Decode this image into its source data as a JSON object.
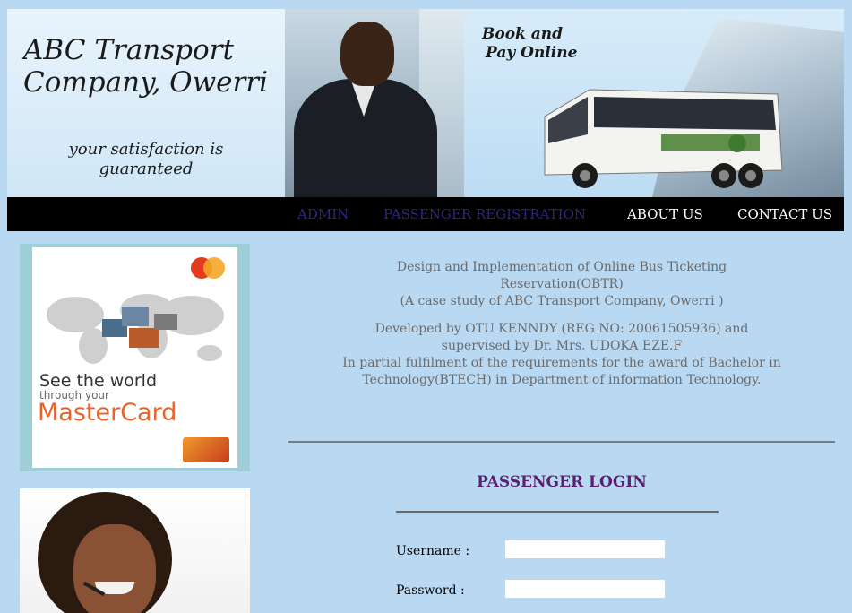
{
  "header": {
    "brand_title": "ABC Transport Company, Owerri",
    "tagline": "your satisfaction is guaranteed",
    "promo_line1": "Book and",
    "promo_line2": "Pay Online"
  },
  "nav": {
    "items": [
      {
        "label": "ADMIN",
        "color": "#3a1f8a"
      },
      {
        "label": "PASSENGER REGISTRATION",
        "color": "#3a1f8a"
      },
      {
        "label": "ABOUT US",
        "color": "#ffffff"
      },
      {
        "label": "CONTACT US",
        "color": "#ffffff"
      }
    ]
  },
  "sidebar": {
    "mastercard_ad": {
      "line1": "See the world",
      "line2": "through your",
      "brand": "MasterCard",
      "brand_color": "#e8632a"
    }
  },
  "main": {
    "project_title_line1": "Design and Implementation of Online Bus Ticketing",
    "project_title_line2": "Reservation(OBTR)",
    "case_study": "(A case study of ABC Transport Company, Owerri )",
    "developer_line1": "Developed by OTU KENNDY (REG NO: 20061505936) and",
    "developer_line2": "supervised by Dr. Mrs. UDOKA EZE.F",
    "requirement_line1": "In partial fulfilment of the requirements for the award of Bachelor in",
    "requirement_line2": "Technology(BTECH) in Department of information Technology."
  },
  "login": {
    "title": "PASSENGER LOGIN",
    "title_color": "#5a1f6e",
    "username_label": "Username :",
    "username_value": "",
    "password_label": "Password :",
    "password_value": ""
  },
  "colors": {
    "page_background": "#b9d9f3",
    "navbar_background": "#000000"
  }
}
